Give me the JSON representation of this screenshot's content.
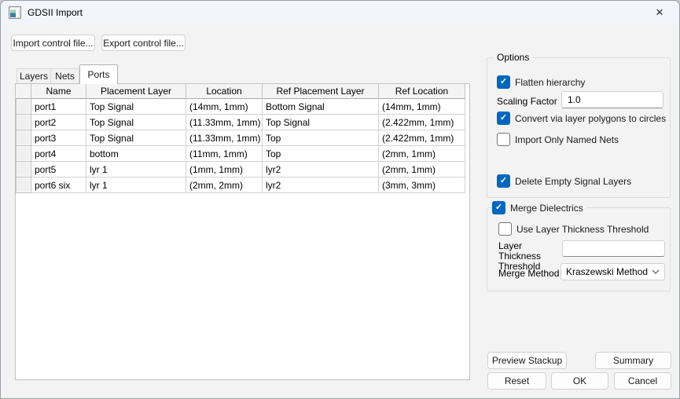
{
  "window": {
    "title": "GDSII Import",
    "close_glyph": "×"
  },
  "toolbar": {
    "import_button": "Import control file...",
    "export_button": "Export control file..."
  },
  "tabs": [
    {
      "label": "Layers",
      "active": false
    },
    {
      "label": "Nets",
      "active": false
    },
    {
      "label": "Ports",
      "active": true
    }
  ],
  "table": {
    "columns": [
      "Name",
      "Placement Layer",
      "Location",
      "Ref Placement Layer",
      "Ref Location"
    ],
    "rows": [
      {
        "name": "port1",
        "placement_layer": "Top Signal",
        "location": "(14mm, 1mm)",
        "ref_placement_layer": "Bottom Signal",
        "ref_location": "(14mm, 1mm)"
      },
      {
        "name": "port2",
        "placement_layer": "Top Signal",
        "location": "(11.33mm, 1mm)",
        "ref_placement_layer": "Top Signal",
        "ref_location": "(2.422mm, 1mm)"
      },
      {
        "name": "port3",
        "placement_layer": "Top Signal",
        "location": "(11.33mm, 1mm)",
        "ref_placement_layer": "Top",
        "ref_location": "(2.422mm, 1mm)"
      },
      {
        "name": "port4",
        "placement_layer": "bottom",
        "location": "(11mm, 1mm)",
        "ref_placement_layer": "Top",
        "ref_location": "(2mm, 1mm)"
      },
      {
        "name": "port5",
        "placement_layer": "lyr 1",
        "location": "(1mm, 1mm)",
        "ref_placement_layer": "lyr2",
        "ref_location": "(2mm, 1mm)"
      },
      {
        "name": "port6 six",
        "placement_layer": "lyr 1",
        "location": "(2mm, 2mm)",
        "ref_placement_layer": "lyr2",
        "ref_location": "(3mm, 3mm)"
      }
    ]
  },
  "options": {
    "title": "Options",
    "flatten_hierarchy": {
      "label": "Flatten hierarchy",
      "checked": true
    },
    "scaling_factor": {
      "label": "Scaling Factor",
      "value": "1.0"
    },
    "convert_via": {
      "label": "Convert via layer polygons to circles",
      "checked": true
    },
    "import_only_named_nets": {
      "label": "Import Only Named Nets",
      "checked": false
    },
    "delete_empty_signal_layers": {
      "label": "Delete Empty Signal Layers",
      "checked": true
    }
  },
  "merge_dielectrics": {
    "label": "Merge Dielectrics",
    "checked": true,
    "use_layer_thickness_threshold": {
      "label": "Use Layer Thickness Threshold",
      "checked": false
    },
    "layer_thickness_threshold": {
      "label": "Layer Thickness Threshold",
      "value": ""
    },
    "merge_method": {
      "label": "Merge Method",
      "value": "Kraszewski Method"
    }
  },
  "actions": {
    "preview_stackup": "Preview Stackup",
    "summary": "Summary",
    "reset": "Reset",
    "ok": "OK",
    "cancel": "Cancel"
  },
  "colors": {
    "accent": "#0067c0",
    "titlebar": "#f2f6fc",
    "body": "#f3f3f3"
  }
}
